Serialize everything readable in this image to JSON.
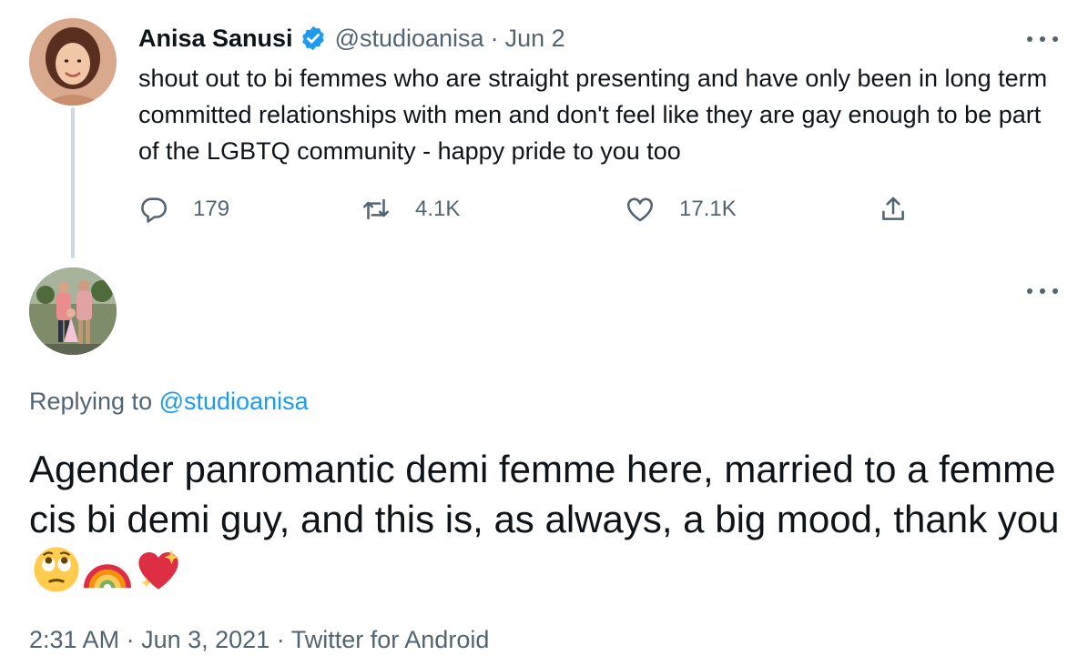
{
  "original_tweet": {
    "author_name": "Anisa Sanusi",
    "handle": "@studioanisa",
    "separator": "·",
    "date": "Jun 2",
    "text": "shout out to bi femmes who are straight presenting and have only been in long term committed relationships with men and don't feel like they are gay enough to be part of the LGBTQ community - happy pride to you too",
    "stats": {
      "replies": "179",
      "retweets": "4.1K",
      "likes": "17.1K"
    },
    "icons": [
      "verified-badge-icon",
      "more-options-icon",
      "reply-icon",
      "retweet-icon",
      "like-heart-icon",
      "share-icon"
    ]
  },
  "reply_tweet": {
    "replying_prefix": "Replying to",
    "replying_handle": "@studioanisa",
    "text": "Agender panromantic demi femme here, married to a femme cis bi demi guy, and this is, as always, a big mood, thank you",
    "emojis": [
      "face-with-rolling-eyes-emoji",
      "rainbow-emoji",
      "sparkling-heart-emoji"
    ],
    "time": "2:31 AM",
    "date": "Jun 3, 2021",
    "source": "Twitter for Android",
    "separator": "·"
  },
  "colors": {
    "text_primary": "#0f1419",
    "text_secondary": "#536471",
    "link": "#1d9bf0",
    "verified": "#1d9bf0",
    "thread_line": "#cfd9de"
  }
}
